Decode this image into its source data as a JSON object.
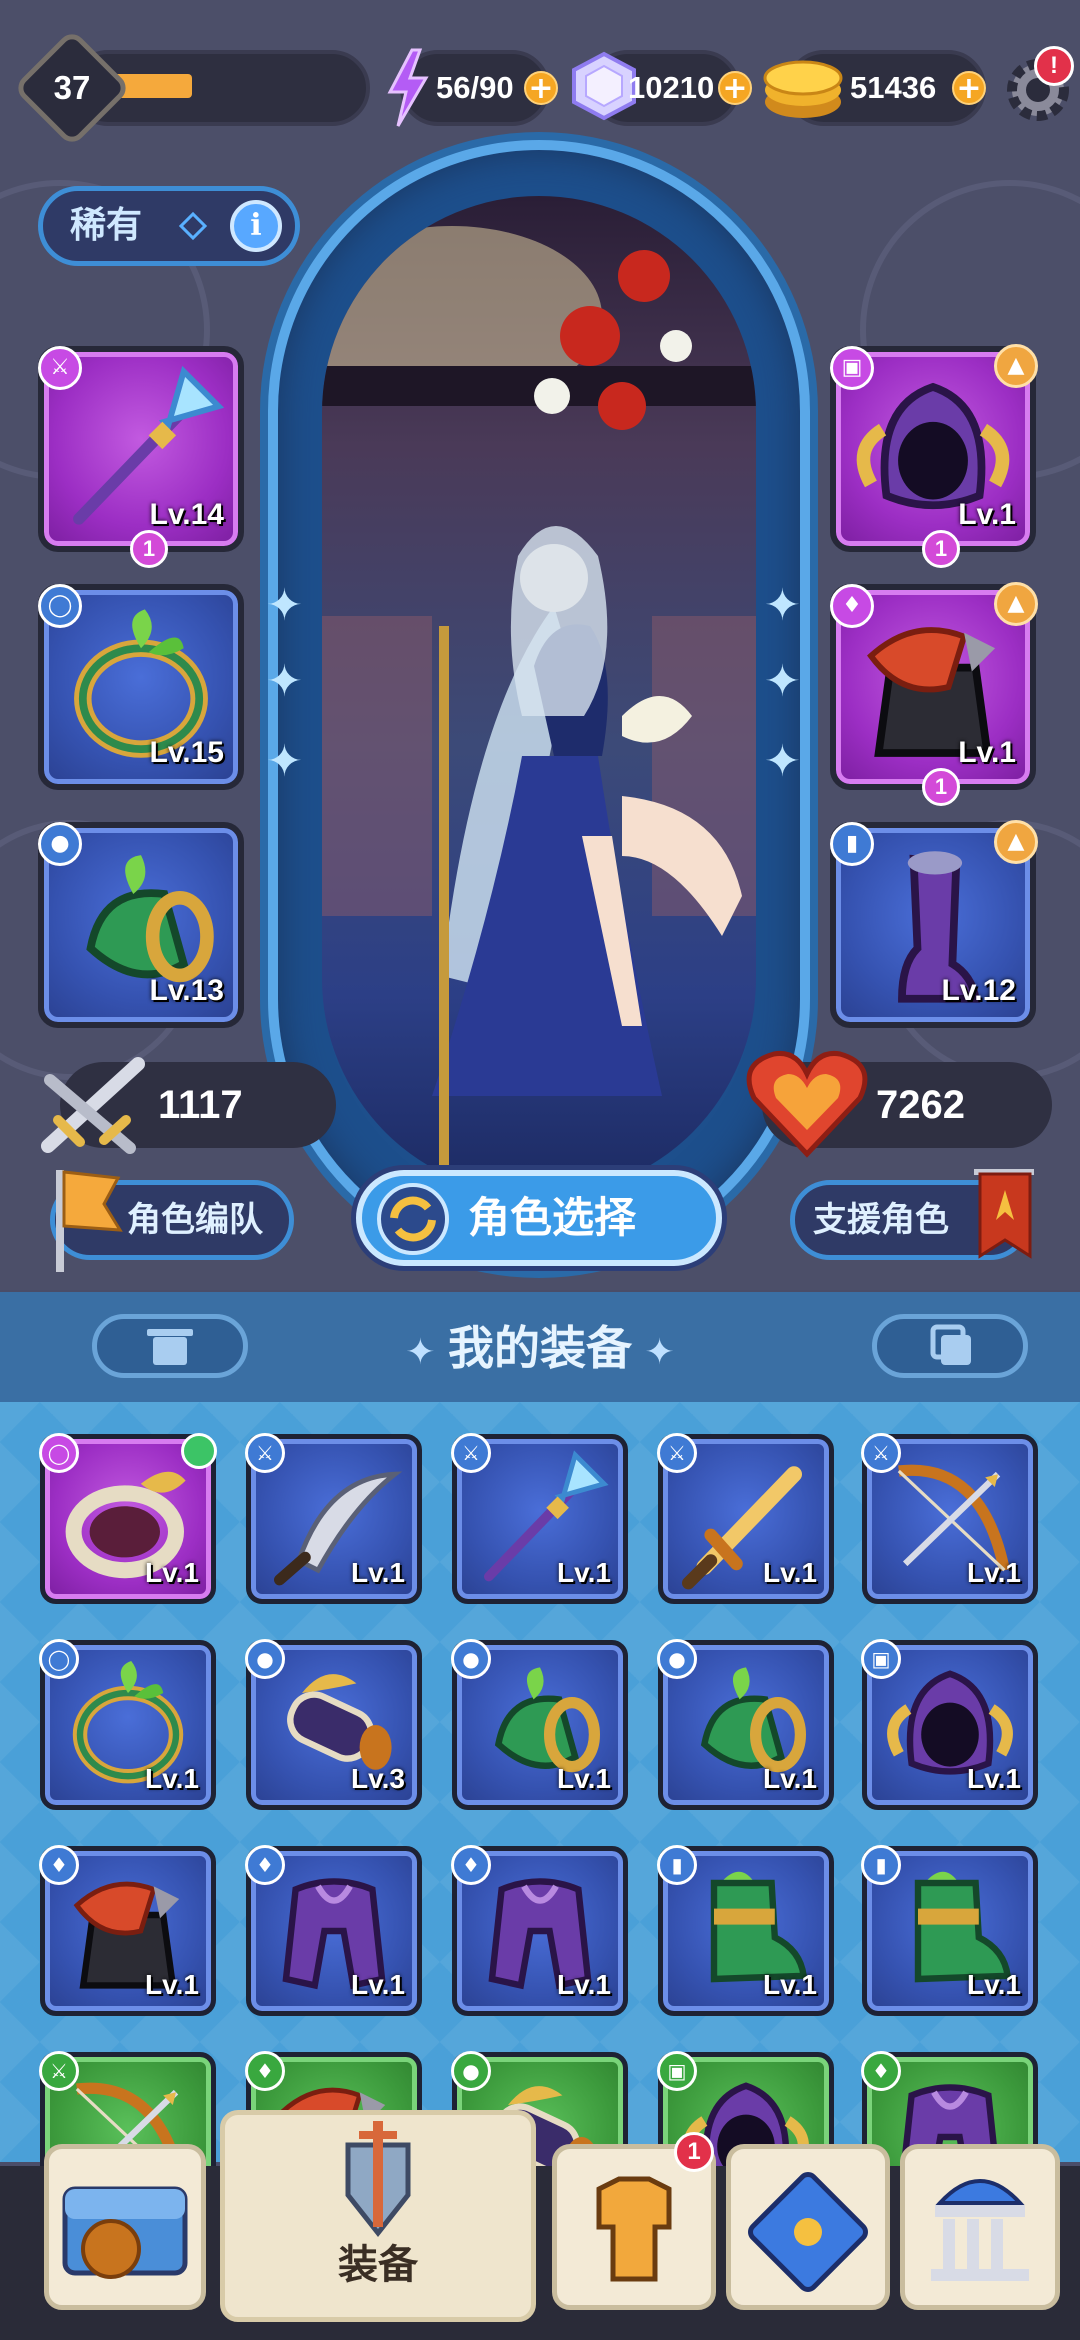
{
  "header": {
    "player_level": "37",
    "xp_progress": 0.34,
    "energy": "56/90",
    "gems": "10210",
    "gold": "51436",
    "settings_alert": "!"
  },
  "character": {
    "rarity": "稀有",
    "attack": "1117",
    "health": "7262",
    "team_button": "角色编队",
    "select_button": "角色选择",
    "support_button": "支援角色"
  },
  "equipped": {
    "left": [
      {
        "lv": "Lv.14",
        "count": "1",
        "color": "purple",
        "icon": "crystal-spear-icon"
      },
      {
        "lv": "Lv.15",
        "count": "",
        "color": "blue",
        "icon": "leaf-ring-icon"
      },
      {
        "lv": "Lv.13",
        "count": "",
        "color": "blue",
        "icon": "leaf-bracer-icon"
      }
    ],
    "right": [
      {
        "lv": "Lv.1",
        "count": "1",
        "color": "purple",
        "icon": "horned-hood-icon"
      },
      {
        "lv": "Lv.1",
        "count": "1",
        "color": "purple",
        "icon": "red-armor-icon"
      },
      {
        "lv": "Lv.12",
        "count": "",
        "color": "blue",
        "icon": "purple-boot-icon"
      }
    ]
  },
  "inventory": {
    "title": "我的装备",
    "items": [
      {
        "lv": "Lv.1",
        "color": "purple",
        "icon": "golden-ring-icon"
      },
      {
        "lv": "Lv.1",
        "color": "blue",
        "icon": "curved-blade-icon"
      },
      {
        "lv": "Lv.1",
        "color": "blue",
        "icon": "crystal-spear-icon"
      },
      {
        "lv": "Lv.1",
        "color": "blue",
        "icon": "golden-sword-icon"
      },
      {
        "lv": "Lv.1",
        "color": "blue",
        "icon": "bow-icon"
      },
      {
        "lv": "Lv.1",
        "color": "blue",
        "icon": "leaf-ring-icon"
      },
      {
        "lv": "Lv.3",
        "color": "blue",
        "icon": "winged-bracer-icon"
      },
      {
        "lv": "Lv.1",
        "color": "blue",
        "icon": "leaf-bracer-icon"
      },
      {
        "lv": "Lv.1",
        "color": "blue",
        "icon": "leaf-bracer-icon"
      },
      {
        "lv": "Lv.1",
        "color": "blue",
        "icon": "horned-hood-icon"
      },
      {
        "lv": "Lv.1",
        "color": "blue",
        "icon": "red-armor-icon"
      },
      {
        "lv": "Lv.1",
        "color": "blue",
        "icon": "purple-robe-icon"
      },
      {
        "lv": "Lv.1",
        "color": "blue",
        "icon": "purple-robe-icon"
      },
      {
        "lv": "Lv.1",
        "color": "blue",
        "icon": "green-boot-icon"
      },
      {
        "lv": "Lv.1",
        "color": "blue",
        "icon": "green-boot-icon"
      },
      {
        "lv": "",
        "color": "green",
        "icon": "bow-icon"
      },
      {
        "lv": "",
        "color": "green",
        "icon": "red-armor-icon"
      },
      {
        "lv": "",
        "color": "green",
        "icon": "winged-bracer-icon"
      },
      {
        "lv": "",
        "color": "green",
        "icon": "horned-hood-icon"
      },
      {
        "lv": "",
        "color": "green",
        "icon": "purple-robe-icon"
      }
    ]
  },
  "nav": {
    "equipment_label": "装备",
    "hero_alert": "1"
  },
  "colors": {
    "rare_blue": "#3552b0",
    "epic_purple": "#9c2ec4",
    "common_green": "#3c9a3c",
    "accent_orange": "#f5a623"
  }
}
